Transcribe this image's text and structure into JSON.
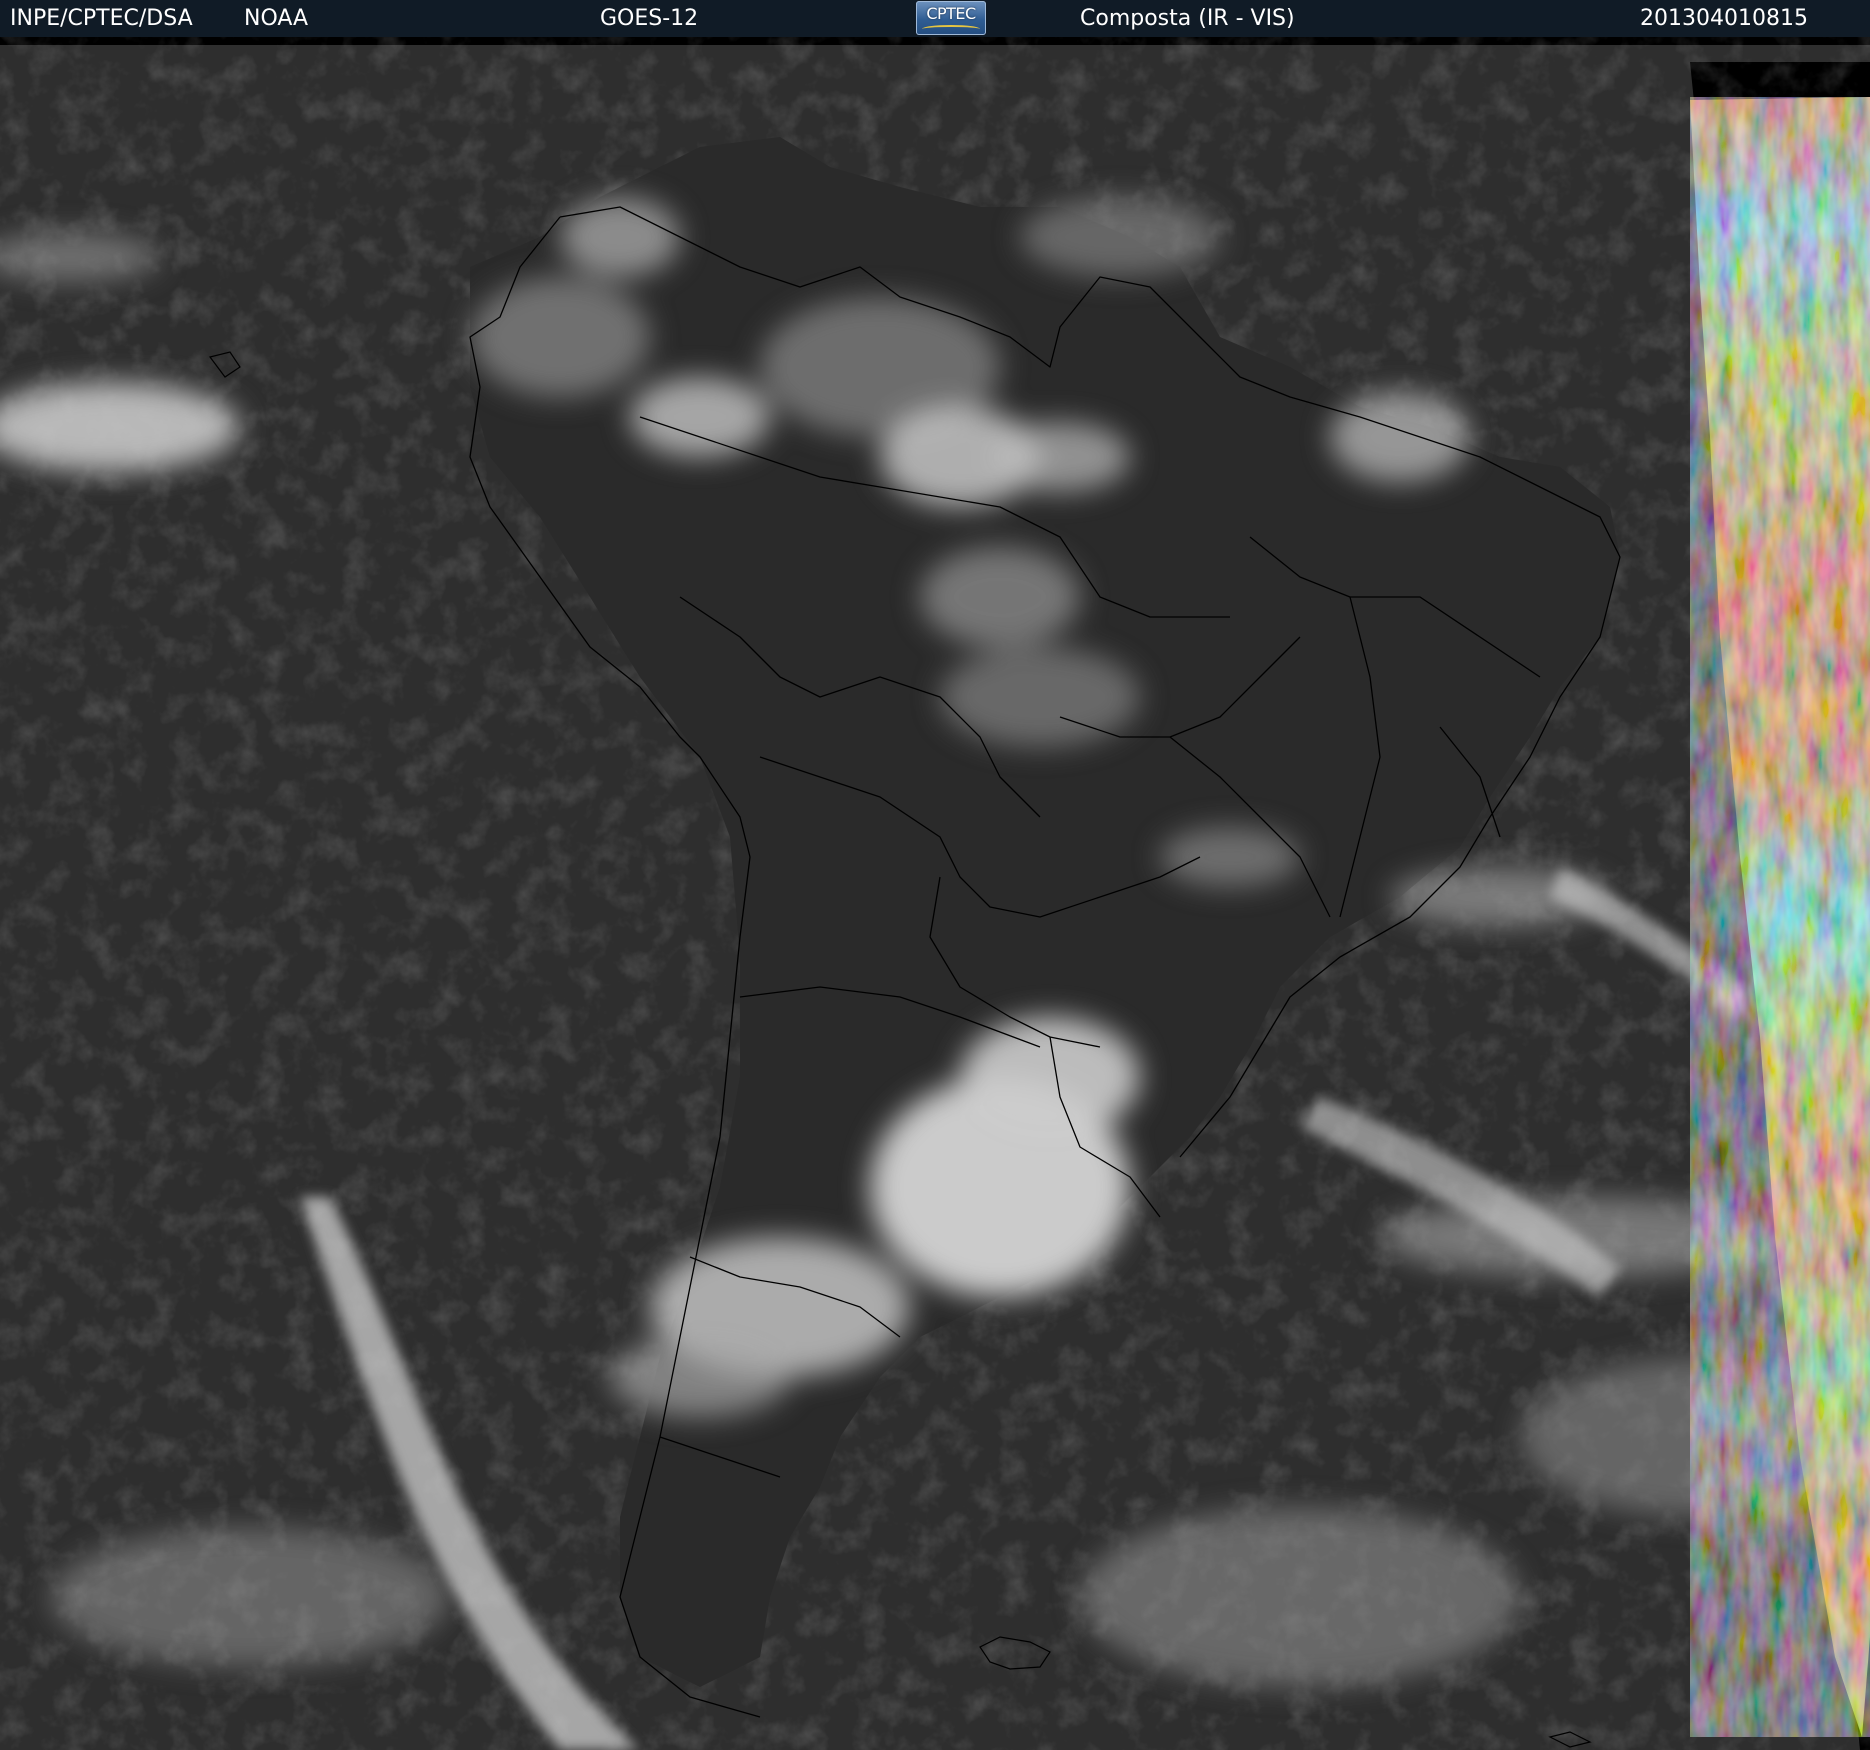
{
  "header": {
    "organization": "INPE/CPTEC/DSA",
    "agency": "NOAA",
    "satellite": "GOES-12",
    "logo_text": "CPTEC",
    "product": "Composta (IR - VIS)",
    "timestamp": "201304010815"
  },
  "image": {
    "type": "satellite-composite",
    "region": "South America",
    "colors": {
      "header_background": "#101b26",
      "header_text": "#ffffff",
      "ocean_dark": "#2a2a2a",
      "cloud": "#d8d8d8",
      "outline": "#000000"
    }
  }
}
